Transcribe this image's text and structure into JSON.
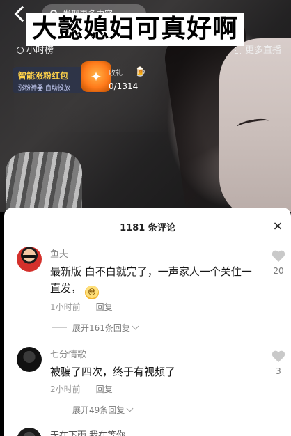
{
  "video": {
    "search_placeholder": "发现更多内容",
    "caption": "大懿媳妇可真好啊",
    "rank_tag": "小时榜",
    "more_live": "更多直播",
    "redpack_title": "智能涨粉红包",
    "redpack_sub": "涨粉神器 自动投放",
    "gift_label": "收礼",
    "gift_count": "0/1314"
  },
  "comments_panel": {
    "title": "1181 条评论",
    "close_icon": "×",
    "comments": [
      {
        "nickname": "鱼夫",
        "text": "最新版 白不白就完了，一声家人一个关住一直发，",
        "time": "1小时前",
        "reply_label": "回复",
        "expand_label": "展开161条回复",
        "likes": "20"
      },
      {
        "nickname": "七分情歌",
        "text": "被骗了四次，终于有视频了",
        "time": "2小时前",
        "reply_label": "回复",
        "expand_label": "展开49条回复",
        "likes": "3"
      },
      {
        "nickname": "天在下雨 我在等你"
      }
    ]
  },
  "colors": {
    "sheet_bg": "#ffffff",
    "nickname": "#8a8a8a",
    "body_text": "#161616",
    "gold_text": "#ffd24a"
  }
}
